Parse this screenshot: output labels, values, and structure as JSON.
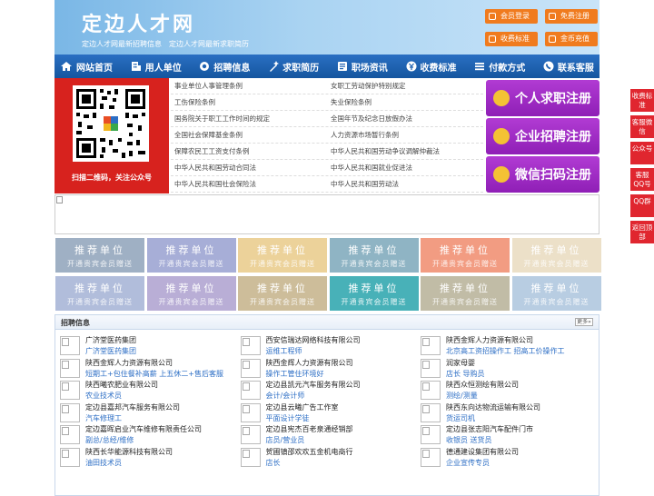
{
  "header": {
    "title": "定边人才网",
    "subtitle": "定边人才网最新招聘信息　定边人才网最新求职简历",
    "buttons": [
      "会员登录",
      "免费注册",
      "收费标准",
      "金币充值"
    ]
  },
  "nav": [
    "网站首页",
    "用人单位",
    "招聘信息",
    "求职简历",
    "职场资讯",
    "收费标准",
    "付款方式",
    "联系客服"
  ],
  "qr": {
    "caption": "扫描二维码，关注公众号"
  },
  "links": [
    [
      "事业单位人事管理条例",
      "女职工劳动保护特别规定"
    ],
    [
      "工伤保险条例",
      "失业保险条例"
    ],
    [
      "国务院关于职工工作时间的规定",
      "全国年节及纪念日放假办法"
    ],
    [
      "全国社会保障基金条例",
      "人力资源市场暂行条例"
    ],
    [
      "保障农民工工资支付条例",
      "中华人民共和国劳动争议调解仲裁法"
    ],
    [
      "中华人民共和国劳动合同法",
      "中华人民共和国就业促进法"
    ],
    [
      "中华人民共和国社会保险法",
      "中华人民共和国劳动法"
    ]
  ],
  "register": [
    "个人求职注册",
    "企业招聘注册",
    "微信扫码注册"
  ],
  "promo": {
    "title": "推荐单位",
    "sub": "开通贵宾会员赠送"
  },
  "promo_colors": [
    "#9fb0c4",
    "#a7aed7",
    "#ecd29a",
    "#8fb4c4",
    "#f29c82",
    "#ece0c8",
    "#b1bddb",
    "#b9aed6",
    "#cdbd9a",
    "#48b1b8",
    "#c1bca6",
    "#b8cde2"
  ],
  "jobs": {
    "title": "招聘信息",
    "more": "更多»",
    "items": [
      {
        "company": "广济堂医药集团",
        "positions": "广济堂医药集团"
      },
      {
        "company": "西安信瑞达网络科技有限公司",
        "positions": "运维工程师"
      },
      {
        "company": "陕西金辉人力资源有限公司",
        "positions": "北京高工资招操作工 招高工价操作工"
      },
      {
        "company": "陕西金辉人力资源有限公司",
        "positions": "短期工+包住餐补高薪 上五休二+售后客服"
      },
      {
        "company": "陕西金辉人力资源有限公司",
        "positions": "操作工管住环境好"
      },
      {
        "company": "润家母婴",
        "positions": "店长 导购员"
      },
      {
        "company": "陕西曦农肥业有限公司",
        "positions": "农业技术员"
      },
      {
        "company": "定边县凯元汽车服务有限公司",
        "positions": "会计/会计师"
      },
      {
        "company": "陕西众恒测绘有限公司",
        "positions": "测绘/测量"
      },
      {
        "company": "定边县嘉邦汽车服务有限公司",
        "positions": "汽车修理工"
      },
      {
        "company": "定边县云曦广告工作室",
        "positions": "平面设计学徒"
      },
      {
        "company": "陕西东向达物流运输有限公司",
        "positions": "货运司机"
      },
      {
        "company": "定边嘉晖启业汽车维修有限责任公司",
        "positions": "副总/总经/维修"
      },
      {
        "company": "定边县宪杰百老泉通经销部",
        "positions": "店员/营业员"
      },
      {
        "company": "定边县张志阳汽车配件门市",
        "positions": "收银员 送货员"
      },
      {
        "company": "陕西长华能源科技有限公司",
        "positions": "油田技术员"
      },
      {
        "company": "贺圃镇邵欢欢五金机电商行",
        "positions": "店长"
      },
      {
        "company": "德通建设集团有限公司",
        "positions": "企业宣传专员"
      }
    ]
  },
  "side": [
    "收费标准",
    "客服微信",
    "公众号",
    "客服QQ号",
    "QQ群",
    "返回顶部"
  ]
}
